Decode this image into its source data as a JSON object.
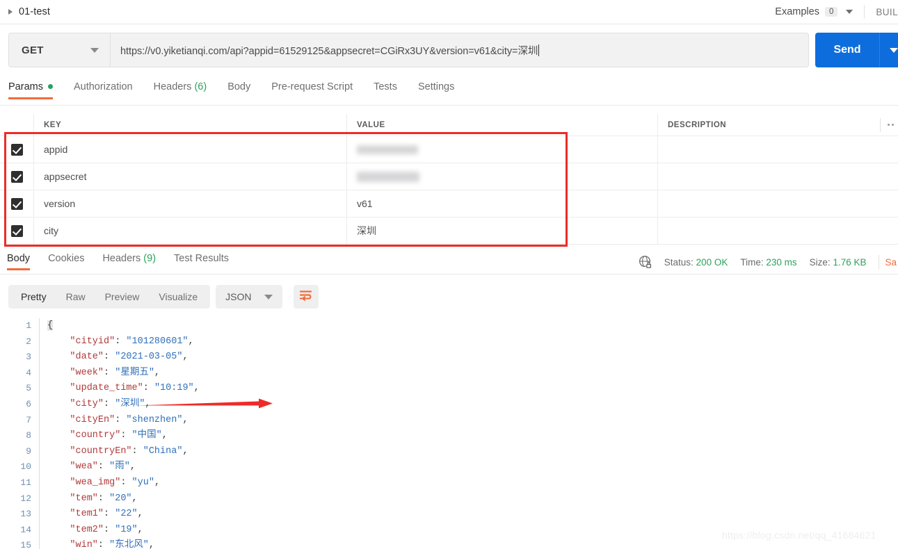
{
  "topbar": {
    "request_title": "01-test",
    "examples_label": "Examples",
    "examples_count": "0",
    "build_label": "BUIL"
  },
  "url_bar": {
    "method": "GET",
    "url": "https://v0.yiketianqi.com/api?appid=61529125&appsecret=CGiRx3UY&version=v61&city=深圳",
    "send_label": "Send"
  },
  "request_tabs": [
    {
      "label": "Params",
      "badge": "",
      "dot": true,
      "active": true
    },
    {
      "label": "Authorization",
      "badge": "",
      "dot": false,
      "active": false
    },
    {
      "label": "Headers",
      "badge": "(6)",
      "dot": false,
      "active": false
    },
    {
      "label": "Body",
      "badge": "",
      "dot": false,
      "active": false
    },
    {
      "label": "Pre-request Script",
      "badge": "",
      "dot": false,
      "active": false
    },
    {
      "label": "Tests",
      "badge": "",
      "dot": false,
      "active": false
    },
    {
      "label": "Settings",
      "badge": "",
      "dot": false,
      "active": false
    }
  ],
  "params_table": {
    "headers": {
      "key": "KEY",
      "value": "VALUE",
      "description": "DESCRIPTION"
    },
    "rows": [
      {
        "checked": true,
        "key": "appid",
        "value": "",
        "value_masked": true,
        "description": ""
      },
      {
        "checked": true,
        "key": "appsecret",
        "value": "",
        "value_masked": true,
        "description": ""
      },
      {
        "checked": true,
        "key": "version",
        "value": "v61",
        "value_masked": false,
        "description": ""
      },
      {
        "checked": true,
        "key": "city",
        "value": "深圳",
        "value_masked": false,
        "description": ""
      }
    ]
  },
  "response_tabs": [
    {
      "label": "Body",
      "badge": "",
      "active": true
    },
    {
      "label": "Cookies",
      "badge": "",
      "active": false
    },
    {
      "label": "Headers",
      "badge": "(9)",
      "active": false
    },
    {
      "label": "Test Results",
      "badge": "",
      "active": false
    }
  ],
  "response_meta": {
    "status_label": "Status:",
    "status_value": "200 OK",
    "time_label": "Time:",
    "time_value": "230 ms",
    "size_label": "Size:",
    "size_value": "1.76 KB",
    "save_label": "Sa"
  },
  "body_toolbar": {
    "views": [
      "Pretty",
      "Raw",
      "Preview",
      "Visualize"
    ],
    "active_view": "Pretty",
    "format": "JSON"
  },
  "json_body": {
    "line_numbers": [
      "1",
      "2",
      "3",
      "4",
      "5",
      "6",
      "7",
      "8",
      "9",
      "10",
      "11",
      "12",
      "13",
      "14",
      "15"
    ],
    "lines": [
      {
        "n": "1",
        "indent": 0,
        "key": "",
        "value": "",
        "punct": "{",
        "raw": true
      },
      {
        "n": "2",
        "indent": 1,
        "key": "cityid",
        "value": "101280601",
        "punct": ","
      },
      {
        "n": "3",
        "indent": 1,
        "key": "date",
        "value": "2021-03-05",
        "punct": ","
      },
      {
        "n": "4",
        "indent": 1,
        "key": "week",
        "value": "星期五",
        "punct": ","
      },
      {
        "n": "5",
        "indent": 1,
        "key": "update_time",
        "value": "10:19",
        "punct": ","
      },
      {
        "n": "6",
        "indent": 1,
        "key": "city",
        "value": "深圳",
        "punct": ","
      },
      {
        "n": "7",
        "indent": 1,
        "key": "cityEn",
        "value": "shenzhen",
        "punct": ","
      },
      {
        "n": "8",
        "indent": 1,
        "key": "country",
        "value": "中国",
        "punct": ","
      },
      {
        "n": "9",
        "indent": 1,
        "key": "countryEn",
        "value": "China",
        "punct": ","
      },
      {
        "n": "10",
        "indent": 1,
        "key": "wea",
        "value": "雨",
        "punct": ","
      },
      {
        "n": "11",
        "indent": 1,
        "key": "wea_img",
        "value": "yu",
        "punct": ","
      },
      {
        "n": "12",
        "indent": 1,
        "key": "tem",
        "value": "20",
        "punct": ","
      },
      {
        "n": "13",
        "indent": 1,
        "key": "tem1",
        "value": "22",
        "punct": ","
      },
      {
        "n": "14",
        "indent": 1,
        "key": "tem2",
        "value": "19",
        "punct": ","
      },
      {
        "n": "15",
        "indent": 1,
        "key": "win",
        "value": "东北风",
        "punct": ","
      }
    ]
  },
  "watermark": "https://blog.csdn.net/qq_41684621",
  "colors": {
    "accent_orange": "#f26b3a",
    "send_blue": "#0d6ddd",
    "status_green": "#2aa35b",
    "annotation_red": "#ee2b26"
  }
}
